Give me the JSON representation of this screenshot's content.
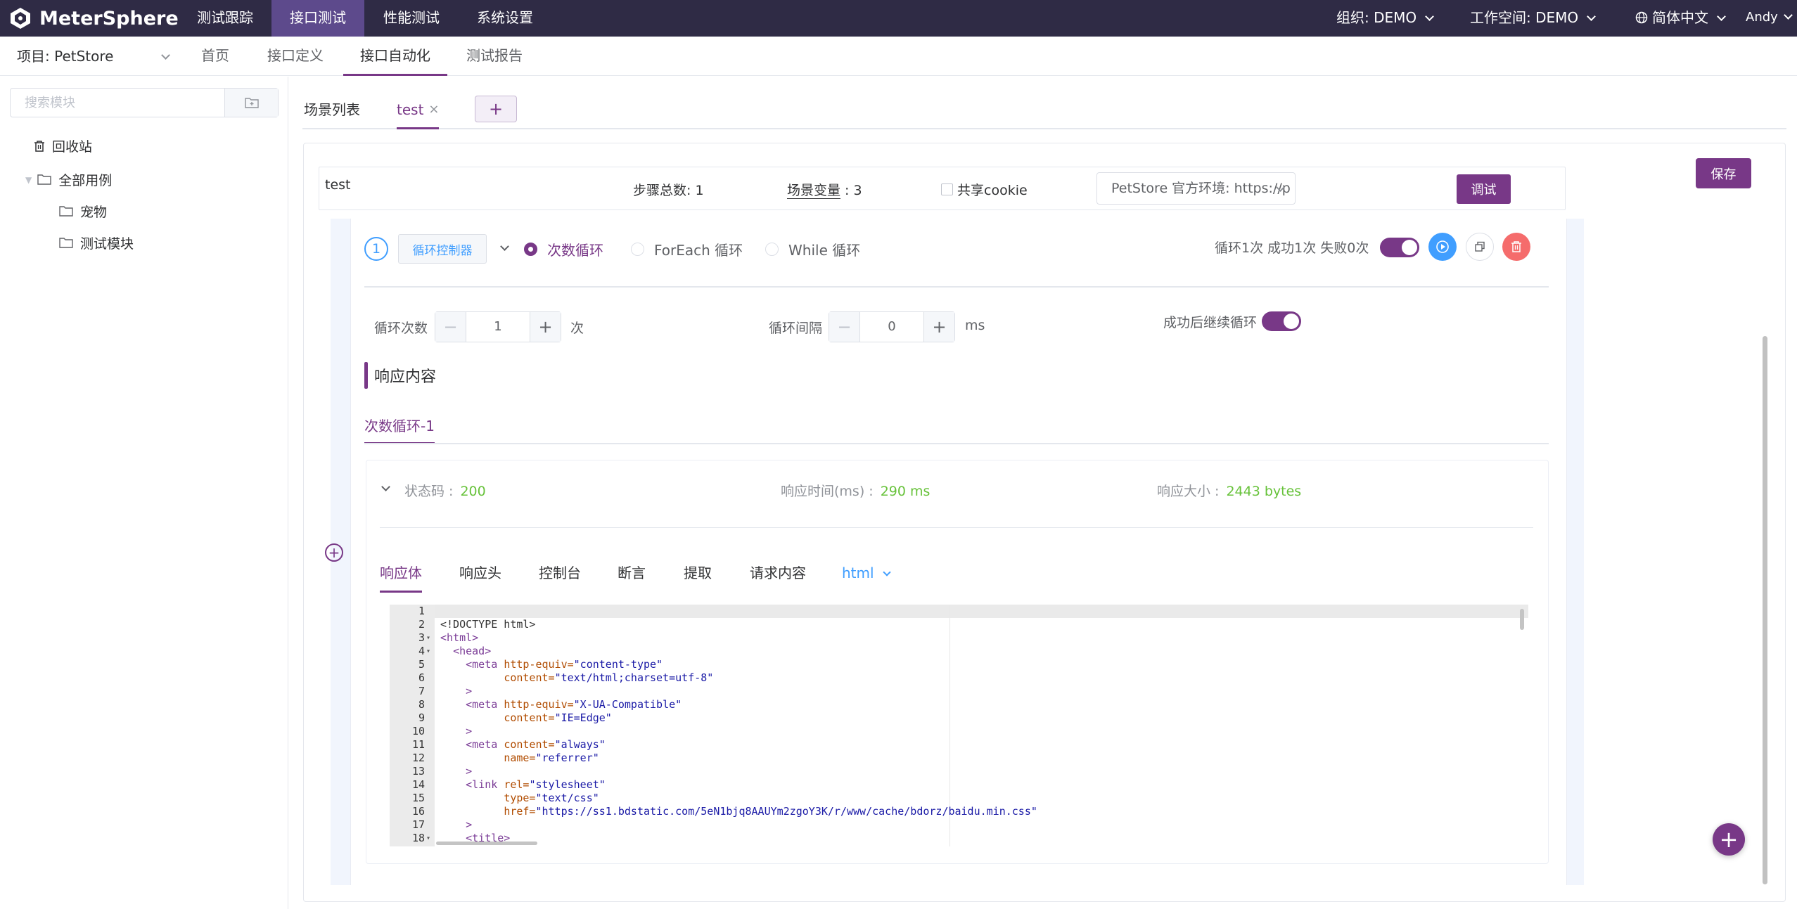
{
  "app": {
    "name": "MeterSphere"
  },
  "topnav": {
    "items": [
      "测试跟踪",
      "接口测试",
      "性能测试",
      "系统设置"
    ],
    "active": "接口测试",
    "org": "组织: DEMO",
    "workspace": "工作空间: DEMO",
    "language": "简体中文",
    "user": "Andy"
  },
  "subnav": {
    "project": "项目: PetStore",
    "items": [
      "首页",
      "接口定义",
      "接口自动化",
      "测试报告"
    ],
    "active": "接口自动化"
  },
  "sidebar": {
    "search_placeholder": "搜索模块",
    "recycle": "回收站",
    "tree": [
      "全部用例",
      "宠物",
      "测试模块"
    ]
  },
  "tabs": {
    "list": "场景列表",
    "current": "test"
  },
  "toolbar": {
    "save": "保存",
    "debug": "调试"
  },
  "scenario": {
    "name": "test",
    "steps_label": "步骤总数: ",
    "steps_value": "1",
    "vars_label": "场景变量",
    "vars_value": "3",
    "share_cookie": "共享cookie",
    "env": "PetStore 官方环境: https://p"
  },
  "loop": {
    "index": "1",
    "tag": "循环控制器",
    "modes": [
      "次数循环",
      "ForEach 循环",
      "While 循环"
    ],
    "selected_mode": "次数循环",
    "summary": "循环1次 成功1次 失败0次",
    "count_label": "循环次数",
    "count_value": "1",
    "count_unit": "次",
    "interval_label": "循环间隔",
    "interval_value": "0",
    "interval_unit": "ms",
    "continue_on_success": "成功后继续循环",
    "enabled": true
  },
  "response": {
    "section_title": "响应内容",
    "tab": "次数循环-1",
    "status_label": "状态码 :",
    "status_value": "200",
    "time_label": "响应时间(ms) :",
    "time_value": "290 ms",
    "size_label": "响应大小 :",
    "size_value": "2443 bytes",
    "inner_tabs": [
      "响应体",
      "响应头",
      "控制台",
      "断言",
      "提取",
      "请求内容"
    ],
    "format": "html"
  },
  "code_lines": [
    {
      "n": "1",
      "fold": "",
      "html": ""
    },
    {
      "n": "2",
      "fold": "",
      "html": "<span class='plain'>&lt;!DOCTYPE html&gt;</span>"
    },
    {
      "n": "3",
      "fold": "▾",
      "html": "<span class='tag'>&lt;html&gt;</span>"
    },
    {
      "n": "4",
      "fold": "▾",
      "html": "  <span class='tag'>&lt;head&gt;</span>"
    },
    {
      "n": "5",
      "fold": "",
      "html": "    <span class='tag'>&lt;meta</span> <span class='attr'>http-equiv=</span><span class='str'>\"content-type\"</span>"
    },
    {
      "n": "6",
      "fold": "",
      "html": "          <span class='attr'>content=</span><span class='str'>\"text/html;charset=utf-8\"</span>"
    },
    {
      "n": "7",
      "fold": "",
      "html": "    <span class='tag'>&gt;</span>"
    },
    {
      "n": "8",
      "fold": "",
      "html": "    <span class='tag'>&lt;meta</span> <span class='attr'>http-equiv=</span><span class='str'>\"X-UA-Compatible\"</span>"
    },
    {
      "n": "9",
      "fold": "",
      "html": "          <span class='attr'>content=</span><span class='str'>\"IE=Edge\"</span>"
    },
    {
      "n": "10",
      "fold": "",
      "html": "    <span class='tag'>&gt;</span>"
    },
    {
      "n": "11",
      "fold": "",
      "html": "    <span class='tag'>&lt;meta</span> <span class='attr'>content=</span><span class='str'>\"always\"</span>"
    },
    {
      "n": "12",
      "fold": "",
      "html": "          <span class='attr'>name=</span><span class='str'>\"referrer\"</span>"
    },
    {
      "n": "13",
      "fold": "",
      "html": "    <span class='tag'>&gt;</span>"
    },
    {
      "n": "14",
      "fold": "",
      "html": "    <span class='tag'>&lt;link</span> <span class='attr'>rel=</span><span class='str'>\"stylesheet\"</span>"
    },
    {
      "n": "15",
      "fold": "",
      "html": "          <span class='attr'>type=</span><span class='str'>\"text/css\"</span>"
    },
    {
      "n": "16",
      "fold": "",
      "html": "          <span class='attr'>href=</span><span class='str'>\"https://ss1.bdstatic.com/5eN1bjq8AAUYm2zgoY3K/r/www/cache/bdorz/baidu.min.css\"</span>"
    },
    {
      "n": "17",
      "fold": "",
      "html": "    <span class='tag'>&gt;</span>"
    },
    {
      "n": "18",
      "fold": "▾",
      "html": "    <span class='tag'>&lt;title&gt;</span>"
    }
  ],
  "colors": {
    "nav_bg": "#2f2b45",
    "nav_active": "#5d4a8c",
    "primary": "#783887",
    "info": "#409eff",
    "danger": "#f56c6c",
    "success": "#67c23a"
  },
  "icons": [
    "logo-icon",
    "globe-icon",
    "folder-add-icon",
    "trash-icon",
    "folder-icon",
    "chevron-down-icon",
    "play-icon",
    "copy-icon",
    "delete-icon",
    "plus-icon",
    "close-icon"
  ]
}
